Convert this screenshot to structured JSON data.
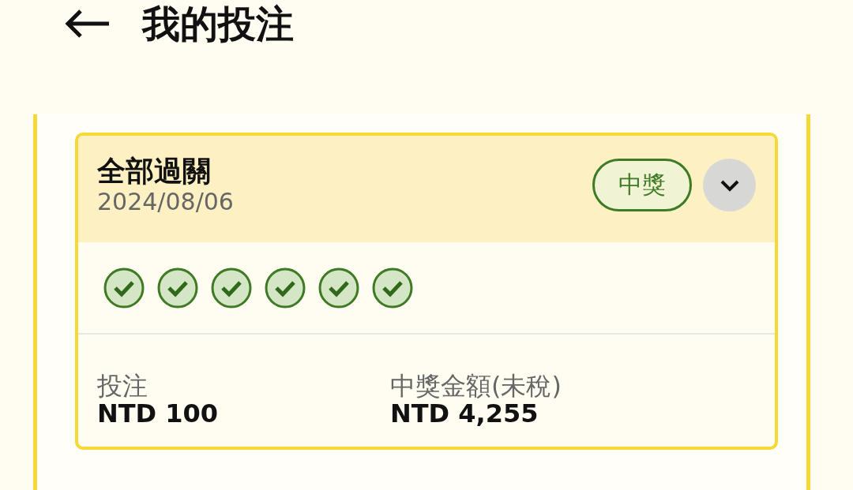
{
  "header": {
    "title": "我的投注"
  },
  "bet_card": {
    "title": "全部過關",
    "date": "2024/08/06",
    "status_badge": "中獎",
    "expanded": false,
    "legs": [
      {
        "won": true
      },
      {
        "won": true
      },
      {
        "won": true
      },
      {
        "won": true
      },
      {
        "won": true
      },
      {
        "won": true
      }
    ],
    "stake": {
      "label": "投注",
      "value": "NTD 100"
    },
    "payout": {
      "label": "中獎金額(未稅)",
      "value": "NTD 4,255"
    }
  }
}
